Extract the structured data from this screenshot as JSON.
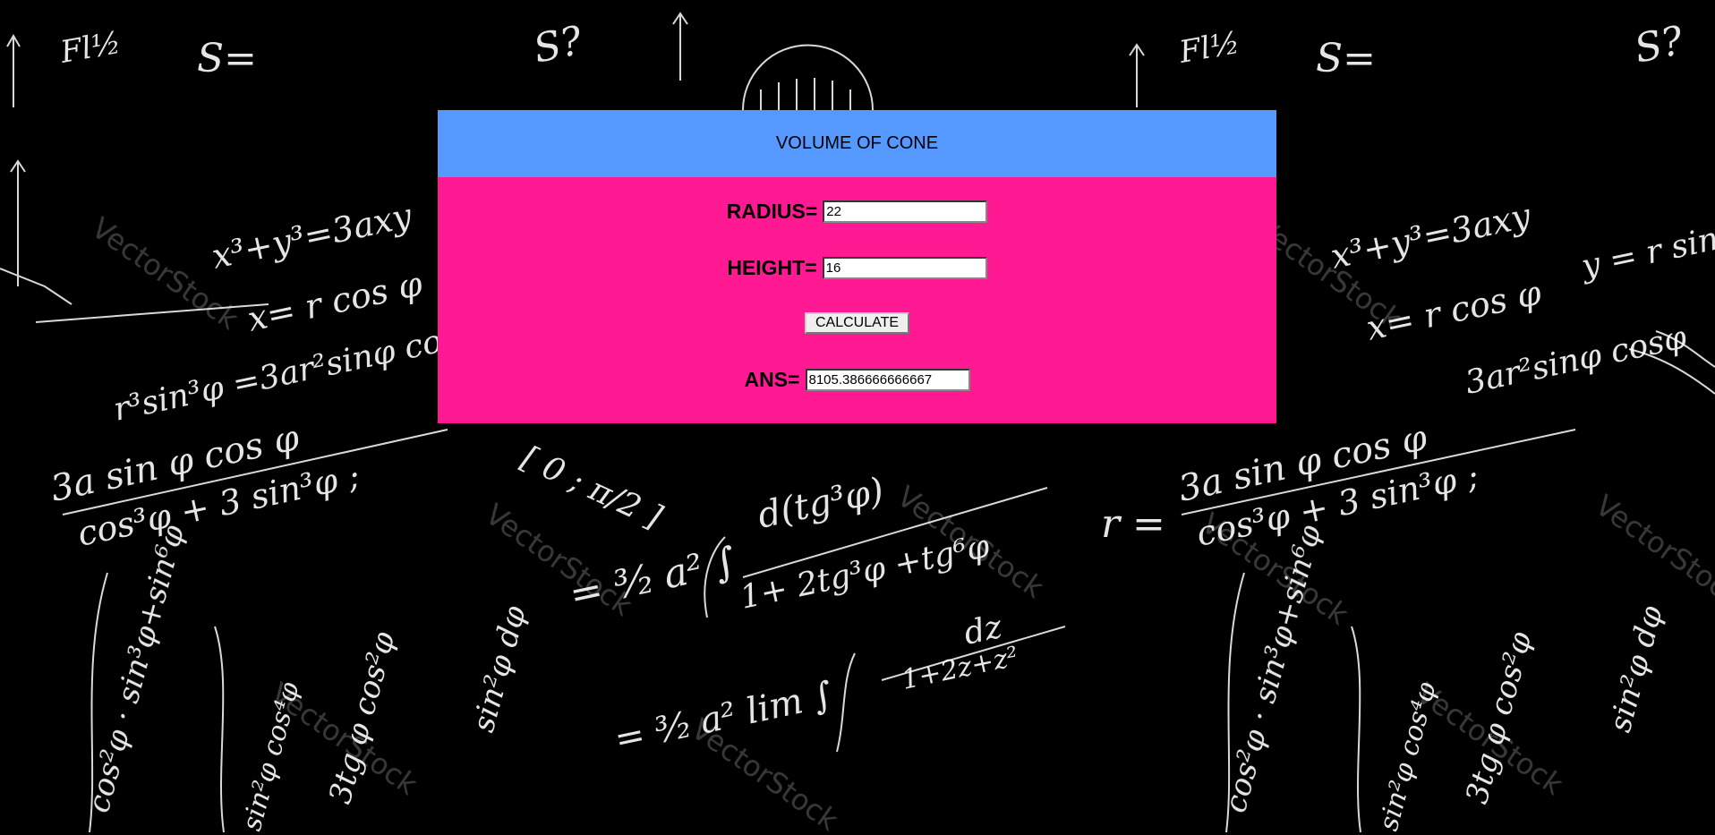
{
  "app": {
    "title": "VOLUME OF CONE"
  },
  "form": {
    "radius_label": "RADIUS=",
    "radius_value": "22",
    "height_label": "HEIGHT=",
    "height_value": "16",
    "calculate_label": "CALCULATE",
    "answer_label": "ANS=",
    "answer_value": "8105.386666666667"
  },
  "background": {
    "watermark": "VectorStock",
    "formulas": [
      "x³+y³=3axy",
      "x= r cos φ",
      "r³ sin³φ =3ar² sinφ cosφ",
      "r = 3a sin φ cos φ / cos³φ + 3 sin³φ",
      "[ 0 ; π/2 ]",
      "= 3/2 a² ∫ d(tg³φ) / 1+ 2tg³φ +tg⁶φ",
      "= 3/2 a² lim ∫ dz / 1+2z+z²",
      "S?",
      "S="
    ]
  },
  "colors": {
    "header_bg": "#5599ff",
    "body_bg": "#ff1a94",
    "page_bg": "#000000",
    "chalk": "#ffffff"
  }
}
